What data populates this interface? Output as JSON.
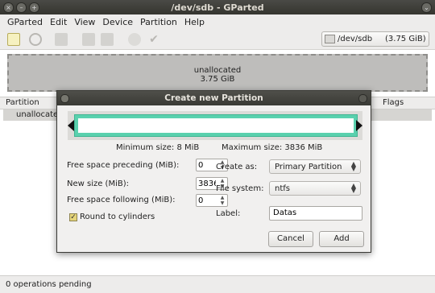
{
  "window": {
    "title": "/dev/sdb - GParted"
  },
  "menu": [
    "GParted",
    "Edit",
    "View",
    "Device",
    "Partition",
    "Help"
  ],
  "toolbar": {
    "device_label": "/dev/sdb",
    "device_size": "(3.75 GiB)"
  },
  "partition_map": {
    "label": "unallocated",
    "size": "3.75 GiB"
  },
  "partition_list": {
    "col_partition": "Partition",
    "col_flags": "Flags",
    "rows": [
      {
        "partition": "unallocated"
      }
    ]
  },
  "status": {
    "text": "0 operations pending"
  },
  "dialog": {
    "title": "Create new Partition",
    "min_size": "Minimum size: 8 MiB",
    "max_size": "Maximum size: 3836 MiB",
    "free_before_label": "Free space preceding (MiB):",
    "free_before_value": "0",
    "new_size_label": "New size (MiB):",
    "new_size_value": "3836",
    "free_after_label": "Free space following (MiB):",
    "free_after_value": "0",
    "round_label": "Round to cylinders",
    "create_as_label": "Create as:",
    "create_as_value": "Primary Partition",
    "fs_label": "File system:",
    "fs_value": "ntfs",
    "label_label": "Label:",
    "label_value": "Datas",
    "cancel": "Cancel",
    "add": "Add"
  },
  "colors": {
    "resizer_fill": "#5ad1ae",
    "titlebar": "#3a3a35",
    "checkbox": "#e4d47a"
  },
  "icons": {
    "toolbar": [
      "new-icon",
      "delete-icon",
      "resize-icon",
      "copy-icon",
      "paste-icon",
      "undo-icon",
      "apply-icon"
    ],
    "device": "harddisk-icon"
  }
}
